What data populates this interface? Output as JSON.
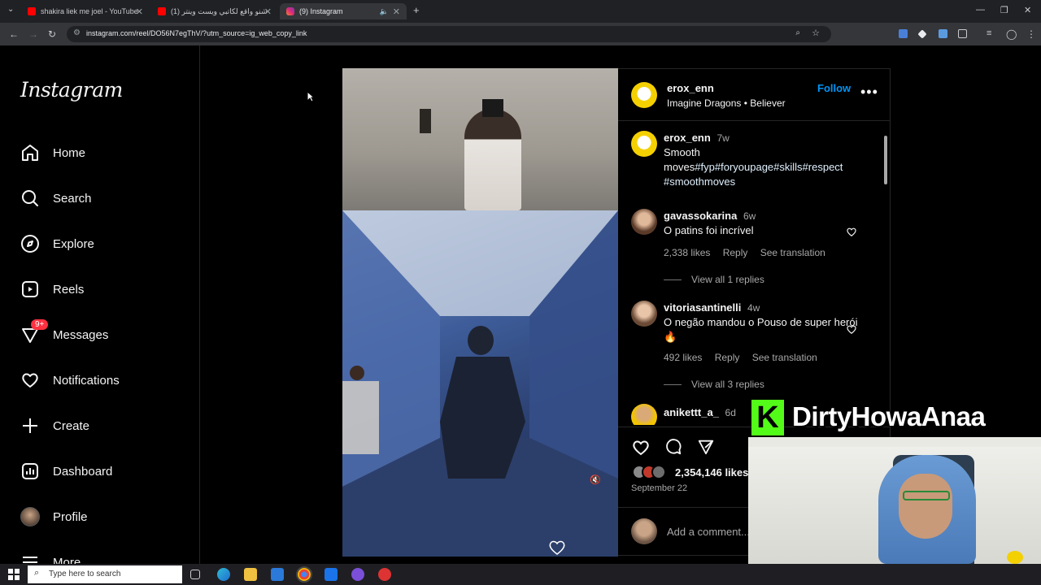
{
  "browser": {
    "tabs": [
      {
        "title": "shakira liek me joel - YouTube",
        "favicon": "youtube-icon"
      },
      {
        "title": "(1) شنو واقع لكاتبي ويست وينتر",
        "favicon": "youtube-icon"
      },
      {
        "title": "(9) Instagram",
        "favicon": "instagram-icon"
      }
    ],
    "url": "instagram.com/reel/DO56N7egThV/?utm_source=ig_web_copy_link"
  },
  "sidebar": {
    "logo": "Instagram",
    "items": [
      {
        "label": "Home",
        "icon": "home-icon"
      },
      {
        "label": "Search",
        "icon": "search-icon"
      },
      {
        "label": "Explore",
        "icon": "compass-icon"
      },
      {
        "label": "Reels",
        "icon": "reels-icon"
      },
      {
        "label": "Messages",
        "icon": "messenger-icon",
        "badge": "9+"
      },
      {
        "label": "Notifications",
        "icon": "heart-icon"
      },
      {
        "label": "Create",
        "icon": "plus-icon"
      },
      {
        "label": "Dashboard",
        "icon": "dashboard-icon"
      },
      {
        "label": "Profile",
        "icon": "avatar"
      },
      {
        "label": "More",
        "icon": "menu-icon"
      }
    ]
  },
  "post": {
    "author": "erox_enn",
    "song_artist": "Imagine Dragons",
    "song_separator": "•",
    "song_title": "Believer",
    "follow_label": "Follow",
    "caption": {
      "user": "erox_enn",
      "age": "7w",
      "line1": "Smooth",
      "line2_text": "moves",
      "hashtags": "#fyp#foryoupage#skills#respect",
      "hashtags2": "#smoothmoves"
    },
    "comments": [
      {
        "user": "gavassokarina",
        "age": "6w",
        "text": "O patins foi incrível",
        "likes": "2,338 likes",
        "reply": "Reply",
        "translate": "See translation",
        "view_replies": "View all 1 replies"
      },
      {
        "user": "vitoriasantinelli",
        "age": "4w",
        "text": "O negão mandou o Pouso de super herói 🔥",
        "likes": "492 likes",
        "reply": "Reply",
        "translate": "See translation",
        "view_replies": "View all 3 replies"
      },
      {
        "user": "anikettt_a_",
        "age": "6d"
      }
    ],
    "like_count": "2,354,146 likes",
    "date": "September 22",
    "add_comment_placeholder": "Add a comment..."
  },
  "overlay": {
    "brand_letter": "K",
    "streamer": "DirtyHowaAnaa"
  },
  "taskbar": {
    "search_placeholder": "Type here to search"
  }
}
